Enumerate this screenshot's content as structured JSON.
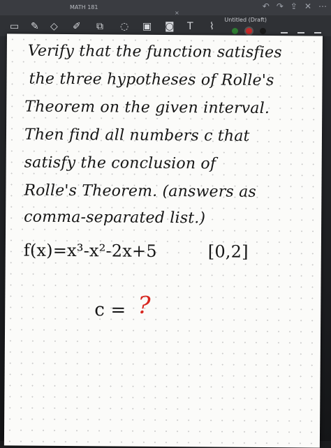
{
  "chrome": {
    "tab_label": "MATH 181",
    "doc_title": "Untitled (Draft)",
    "close_glyph": "×",
    "top_icons": [
      "undo-icon",
      "redo-icon",
      "export-icon",
      "close-icon",
      "more-icon"
    ]
  },
  "toolbar": {
    "tools": [
      "pen-icon",
      "eraser-icon",
      "highlighter-icon",
      "shapes-icon",
      "lasso-icon",
      "image-icon",
      "camera-icon",
      "text-icon",
      "link-icon"
    ],
    "colors": [
      "#2e7d32",
      "#c62828",
      "#1a1a1a"
    ]
  },
  "note": {
    "lines": [
      "Verify that the function satisfies",
      "the three hypotheses of Rolle's",
      "Theorem on the given interval.",
      "Then find all numbers c that",
      "satisfy the conclusion of",
      "Rolle's Theorem. (answers as",
      "comma-separated list.)"
    ],
    "function": "f(x)=x³-x²-2x+5",
    "interval": "[0,2]",
    "answer_label": "c =",
    "answer_value": "?"
  }
}
